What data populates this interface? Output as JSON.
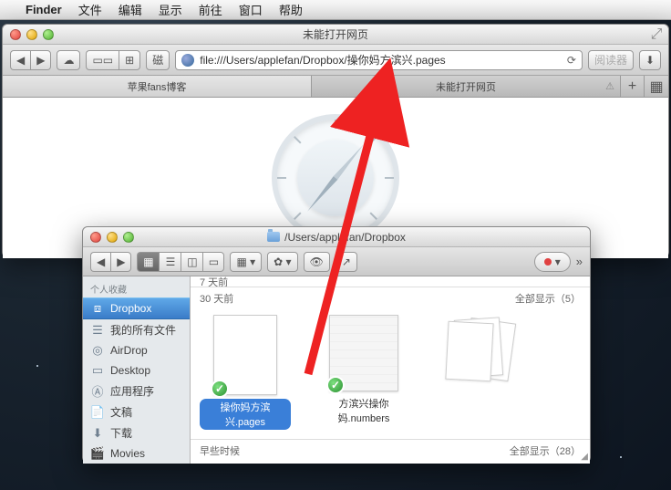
{
  "menubar": {
    "app": "Finder",
    "items": [
      "文件",
      "编辑",
      "显示",
      "前往",
      "窗口",
      "帮助"
    ]
  },
  "safari": {
    "title": "未能打开网页",
    "back": "◀",
    "fwd": "▶",
    "cloud": "☁",
    "bookmark_label": "磁",
    "url": "file:///Users/applefan/Dropbox/操你妈方滨兴.pages",
    "refresh": "⟳",
    "reader": "阅读器",
    "dl": "⬇",
    "tabs": [
      {
        "label": "苹果fans博客",
        "active": true
      },
      {
        "label": "未能打开网页",
        "active": false
      }
    ],
    "addtab": "+"
  },
  "finder": {
    "path": "/Users/applefan/Dropbox",
    "back": "◀",
    "fwd": "▶",
    "gear": "✿ ▾",
    "eye": "👁",
    "share": "↗",
    "chevron": "»",
    "sidebar": {
      "header": "个人收藏",
      "items": [
        {
          "icon": "dropbox",
          "label": "Dropbox",
          "sel": true
        },
        {
          "icon": "home",
          "label": "我的所有文件"
        },
        {
          "icon": "airdrop",
          "label": "AirDrop"
        },
        {
          "icon": "desktop",
          "label": "Desktop"
        },
        {
          "icon": "apps",
          "label": "应用程序"
        },
        {
          "icon": "docs",
          "label": "文稿"
        },
        {
          "icon": "dl",
          "label": "下载"
        },
        {
          "icon": "movie",
          "label": "Movies"
        }
      ]
    },
    "sections": [
      {
        "label_prev": "7 天前"
      },
      {
        "label": "30 天前",
        "showall": "全部显示（5）",
        "files": [
          {
            "name": "操你妈方滨兴.pages",
            "selected": true,
            "type": "pages"
          },
          {
            "name": "方滨兴操你妈.numbers",
            "selected": false,
            "type": "numbers"
          }
        ],
        "stack": true
      },
      {
        "label": "早些时候",
        "showall": "全部显示（28）"
      }
    ]
  }
}
